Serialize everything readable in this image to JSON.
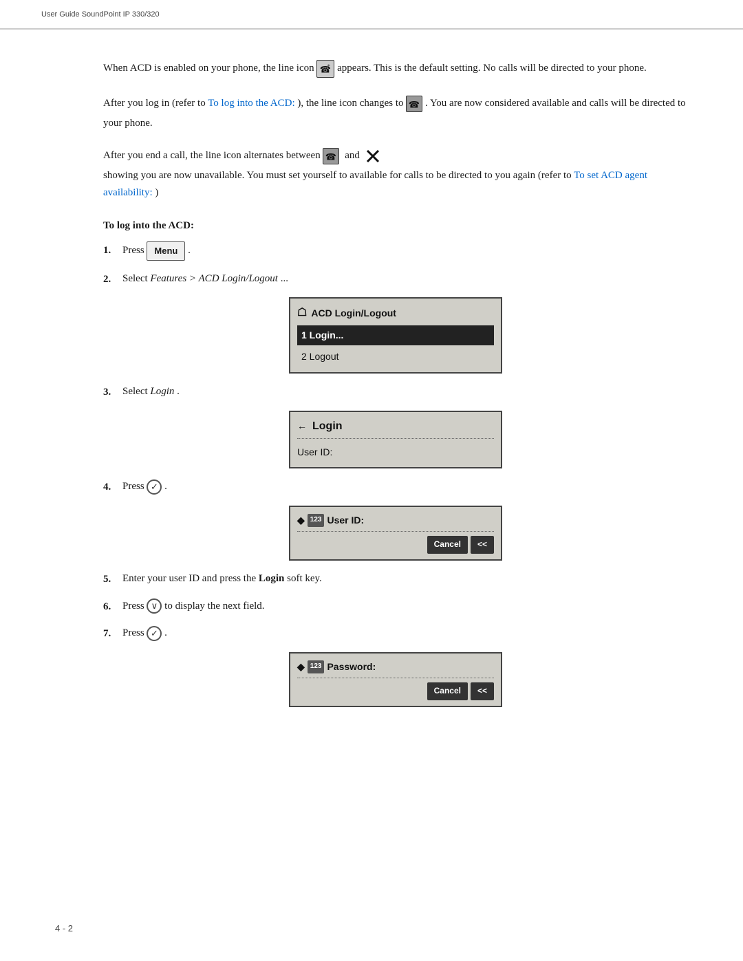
{
  "header": {
    "title": "User Guide SoundPoint IP 330/320"
  },
  "page_number": "4 - 2",
  "paragraphs": {
    "p1_start": "When ACD is enabled on your phone, the line icon",
    "p1_end": "appears. This is the default setting. No calls will be directed to your phone.",
    "p2_start": "After you log in (refer to",
    "p2_link": "To log into the ACD:",
    "p2_end": "), the line icon changes to",
    "p2_end2": ". You are now considered available and calls will be directed to your phone.",
    "p3_start": "After you end a call, the line icon alternates between",
    "p3_and": "and",
    "p3_end": "showing you are now unavailable. You must set yourself to available for calls to be directed to you again (refer to",
    "p3_link": "To set ACD agent availability:",
    "p3_end2": ")"
  },
  "section_heading": "To log into the ACD:",
  "steps": [
    {
      "num": "1.",
      "text_before": "Press",
      "button_label": "Menu",
      "text_after": "."
    },
    {
      "num": "2.",
      "text_before": "Select",
      "italic": "Features > ACD Login/Logout",
      "text_after": "..."
    },
    {
      "num": "3.",
      "text_before": "Select",
      "italic": "Login",
      "text_after": "."
    },
    {
      "num": "4.",
      "text_before": "Press",
      "icon": "checkmark",
      "text_after": "."
    },
    {
      "num": "5.",
      "text_before": "Enter your user ID and press the",
      "bold": "Login",
      "text_after": "soft key."
    },
    {
      "num": "6.",
      "text_before": "Press",
      "icon": "chevron-down",
      "text_after": "to display the next field."
    },
    {
      "num": "7.",
      "text_before": "Press",
      "icon": "checkmark",
      "text_after": "."
    }
  ],
  "screens": {
    "acd_menu": {
      "title": "ACD Login/Logout",
      "items": [
        {
          "text": "1 Login...",
          "selected": true
        },
        {
          "text": "2 Logout",
          "selected": false
        }
      ]
    },
    "login_screen": {
      "title": "Login",
      "field": "User ID:"
    },
    "userid_input": {
      "label": "123",
      "field": "User ID:",
      "softkeys": [
        "Cancel",
        "<<"
      ]
    },
    "password_input": {
      "label": "123",
      "field": "Password:",
      "softkeys": [
        "Cancel",
        "<<"
      ]
    }
  }
}
